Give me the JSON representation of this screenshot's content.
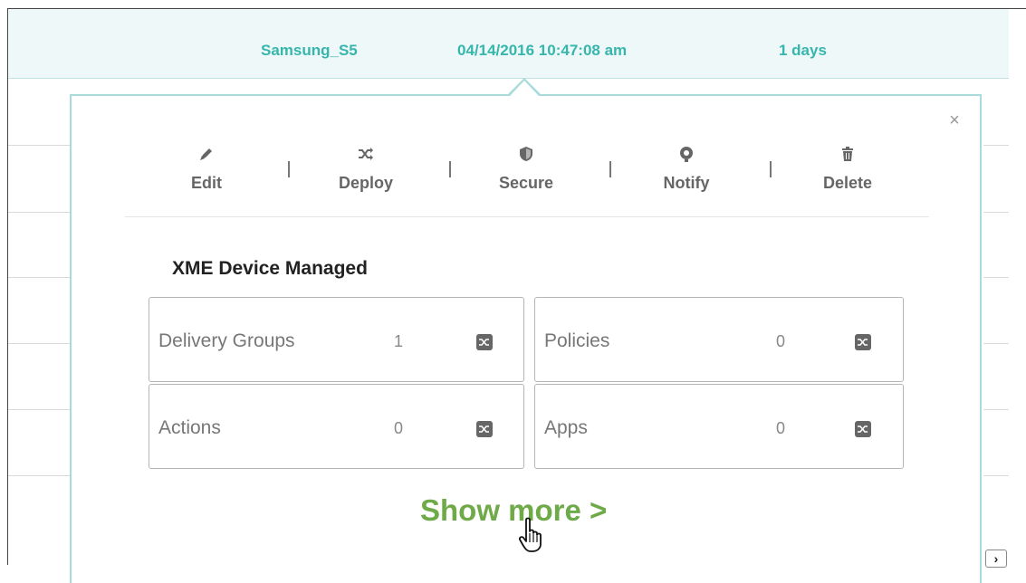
{
  "device_row": {
    "device_name": "Samsung_S5",
    "timestamp": "04/14/2016 10:47:08 am",
    "duration": "1 days"
  },
  "popover": {
    "close_symbol": "×",
    "actions": [
      {
        "label": "Edit",
        "icon": "pencil-icon"
      },
      {
        "label": "Deploy",
        "icon": "shuffle-icon"
      },
      {
        "label": "Secure",
        "icon": "shield-icon"
      },
      {
        "label": "Notify",
        "icon": "bell-icon"
      },
      {
        "label": "Delete",
        "icon": "trash-icon"
      }
    ],
    "section_title": "XME Device Managed",
    "cards": [
      {
        "label": "Delivery Groups",
        "count": "1",
        "icon": "shuffle-icon"
      },
      {
        "label": "Policies",
        "count": "0",
        "icon": "shuffle-icon"
      },
      {
        "label": "Actions",
        "count": "0",
        "icon": "shuffle-icon"
      },
      {
        "label": "Apps",
        "count": "0",
        "icon": "shuffle-icon"
      }
    ],
    "show_more": "Show more >"
  },
  "pagination": {
    "next_symbol": "›"
  },
  "colors": {
    "accent_teal": "#36b6ad",
    "popover_border": "#a9dbdb",
    "show_more_green": "#6faa49",
    "row_highlight": "#eef8f8"
  }
}
